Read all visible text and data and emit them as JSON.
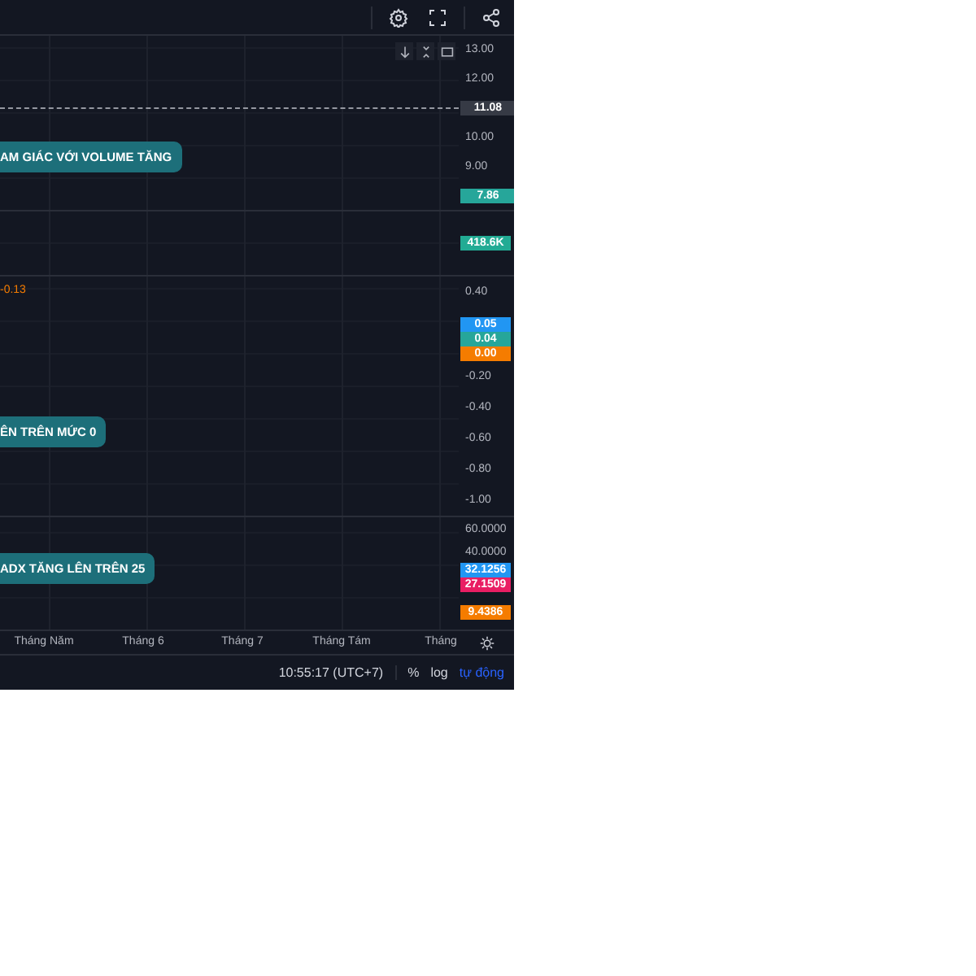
{
  "panes": [
    {
      "kind": "price",
      "callout": "AM GIÁC VỚI VOLUME TĂNG",
      "axis": [
        {
          "kind": "tick",
          "text": "13.00"
        },
        {
          "kind": "tick",
          "text": "12.00"
        },
        {
          "kind": "badge",
          "text": "11.08",
          "color": "#363a45"
        },
        {
          "kind": "tick",
          "text": "10.00"
        },
        {
          "kind": "tick",
          "text": "9.00"
        },
        {
          "kind": "badge",
          "text": "7.86",
          "color": "#26a69a"
        }
      ]
    },
    {
      "kind": "volume",
      "axis": [
        {
          "kind": "badge",
          "text": "418.6K",
          "color": "#22ab94"
        }
      ]
    },
    {
      "kind": "macd",
      "value_label": "-0.13",
      "callout": "ÊN TRÊN MỨC 0",
      "axis": [
        {
          "kind": "tick",
          "text": "0.40"
        },
        {
          "kind": "badge",
          "text": "0.05",
          "color": "#2196f3"
        },
        {
          "kind": "badge",
          "text": "0.04",
          "color": "#26a69a"
        },
        {
          "kind": "badge",
          "text": "0.00",
          "color": "#f57c00"
        },
        {
          "kind": "tick",
          "text": "-0.20"
        },
        {
          "kind": "tick",
          "text": "-0.40"
        },
        {
          "kind": "tick",
          "text": "-0.60"
        },
        {
          "kind": "tick",
          "text": "-0.80"
        },
        {
          "kind": "tick",
          "text": "-1.00"
        }
      ]
    },
    {
      "kind": "adx",
      "callout": "ADX TĂNG LÊN TRÊN 25",
      "axis": [
        {
          "kind": "tick",
          "text": "60.0000"
        },
        {
          "kind": "tick",
          "text": "40.0000"
        },
        {
          "kind": "badge",
          "text": "32.1256",
          "color": "#2196f3"
        },
        {
          "kind": "badge",
          "text": "27.1509",
          "color": "#e91e63"
        },
        {
          "kind": "badge",
          "text": "9.4386",
          "color": "#f57c00"
        }
      ]
    }
  ],
  "time_axis": [
    "Tháng Năm",
    "Tháng 6",
    "Tháng 7",
    "Tháng Tám",
    "Tháng"
  ],
  "status_bar": {
    "time": "10:55:17 (UTC+7)",
    "options": [
      {
        "label": "%",
        "selected": false
      },
      {
        "label": "log",
        "selected": false
      },
      {
        "label": "tự động",
        "selected": true
      }
    ]
  }
}
